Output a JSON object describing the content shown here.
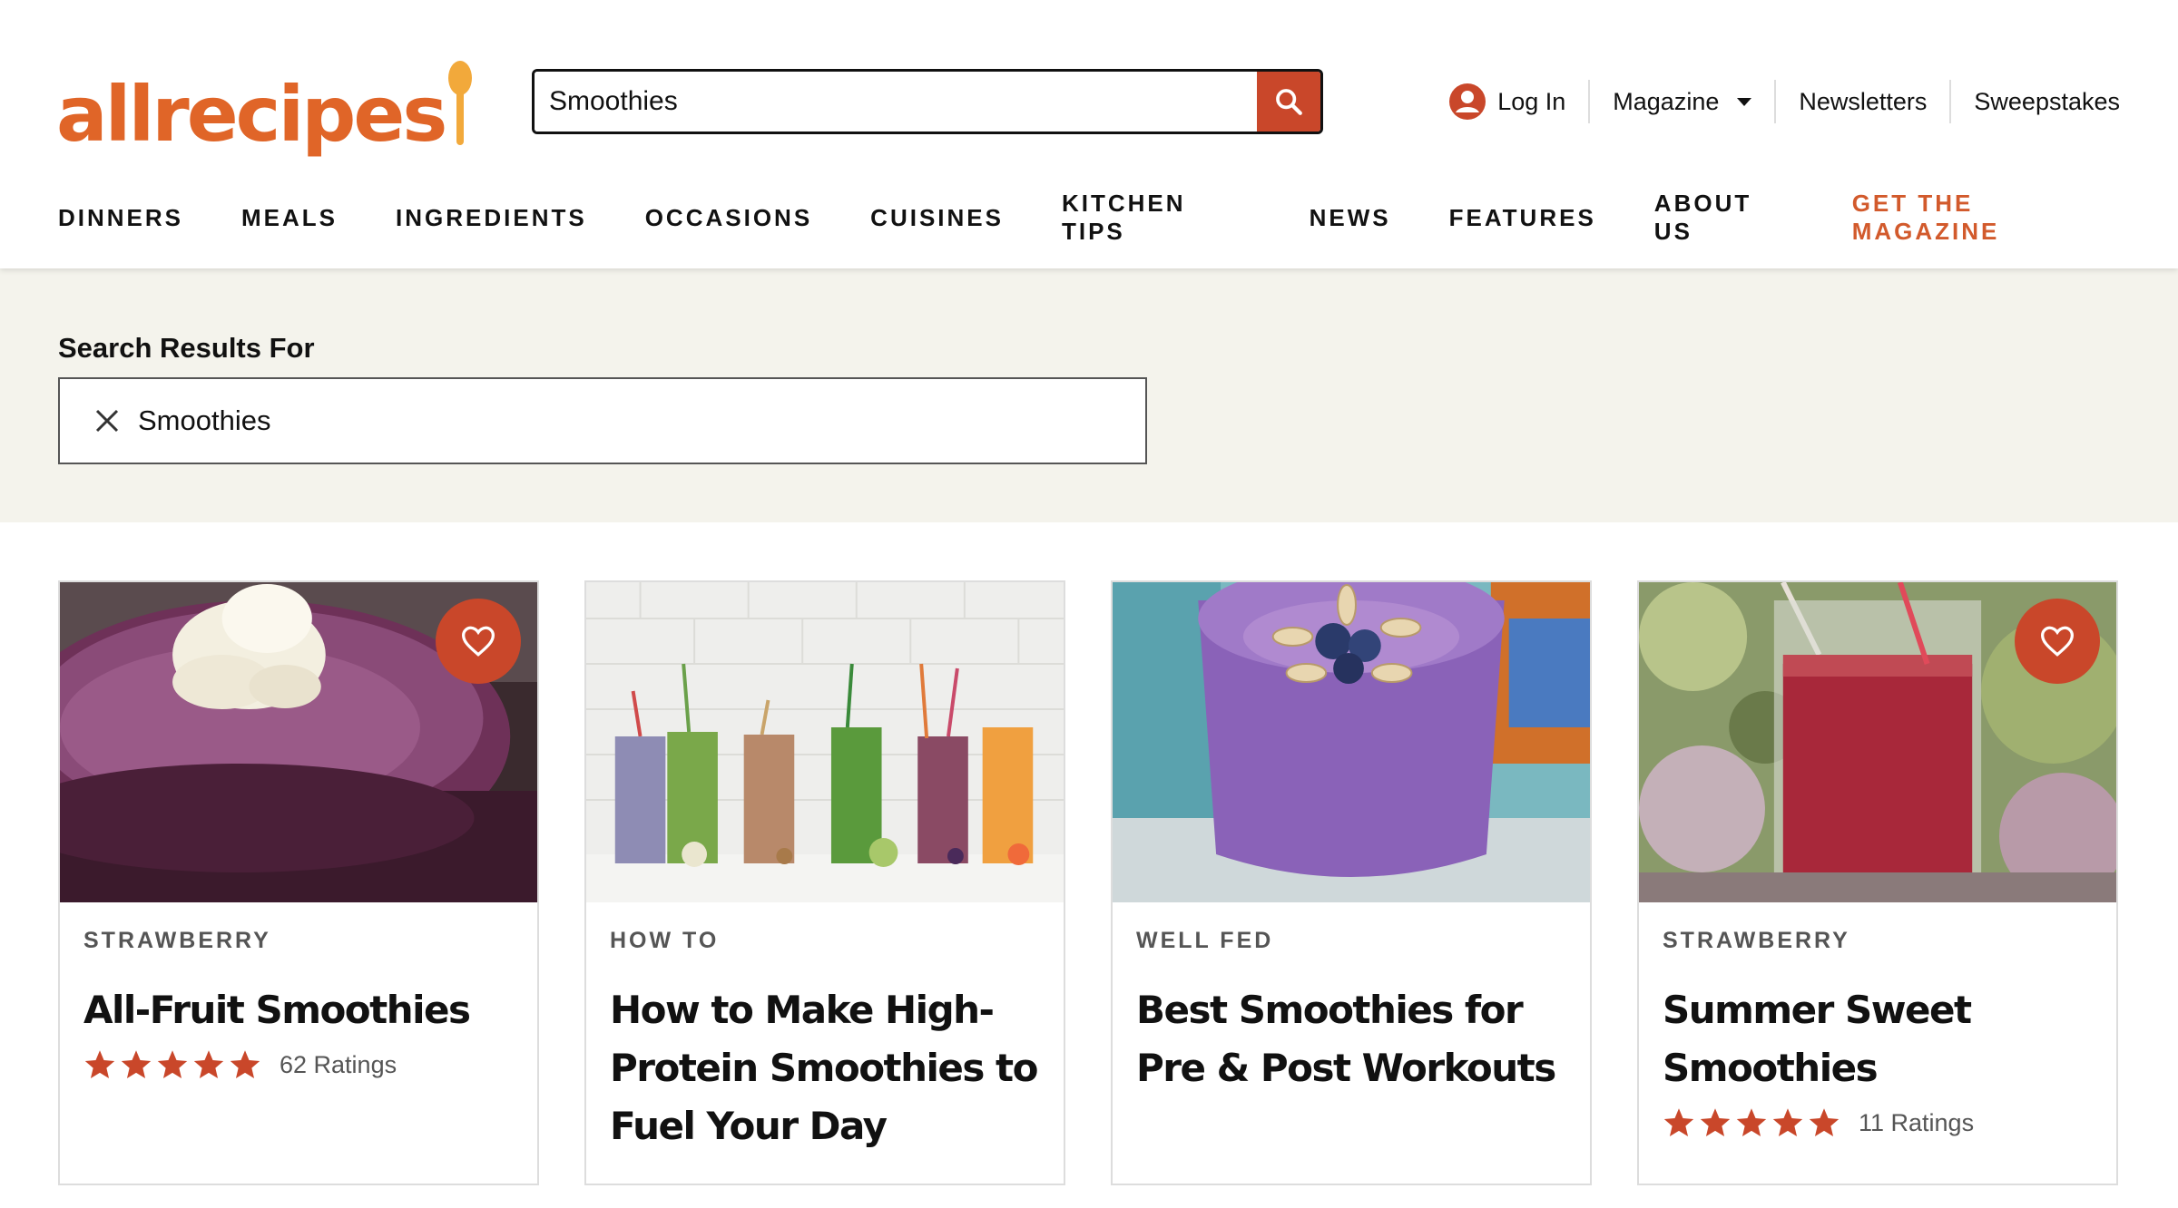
{
  "brand": {
    "logo_text": "allrecipes",
    "accent": "#e06528",
    "button_color": "#c9472a"
  },
  "search": {
    "value": "Smoothies",
    "placeholder": "Find a recipe or ingredient"
  },
  "utility_nav": {
    "login": "Log In",
    "magazine": "Magazine",
    "newsletters": "Newsletters",
    "sweepstakes": "Sweepstakes"
  },
  "main_nav": {
    "items": [
      "DINNERS",
      "MEALS",
      "INGREDIENTS",
      "OCCASIONS",
      "CUISINES",
      "KITCHEN TIPS",
      "NEWS",
      "FEATURES",
      "ABOUT US"
    ],
    "cta": "GET THE MAGAZINE"
  },
  "results": {
    "label": "Search Results For",
    "query": "Smoothies"
  },
  "cards": [
    {
      "tag": "STRAWBERRY",
      "title": "All-Fruit Smoothies",
      "rating": 5,
      "ratings_label": "62 Ratings",
      "favorite": true,
      "image": "purple-smoothie-whipped-cream"
    },
    {
      "tag": "HOW TO",
      "title": "How to Make High-Protein Smoothies to Fuel Your Day",
      "rating": null,
      "ratings_label": null,
      "favorite": false,
      "image": "row-of-smoothies"
    },
    {
      "tag": "WELL FED",
      "title": "Best Smoothies for Pre & Post Workouts",
      "rating": null,
      "ratings_label": null,
      "favorite": false,
      "image": "blueberry-smoothie-almonds"
    },
    {
      "tag": "STRAWBERRY",
      "title": "Summer Sweet Smoothies",
      "rating": 5,
      "ratings_label": "11 Ratings",
      "favorite": true,
      "image": "red-smoothie-glass"
    }
  ]
}
